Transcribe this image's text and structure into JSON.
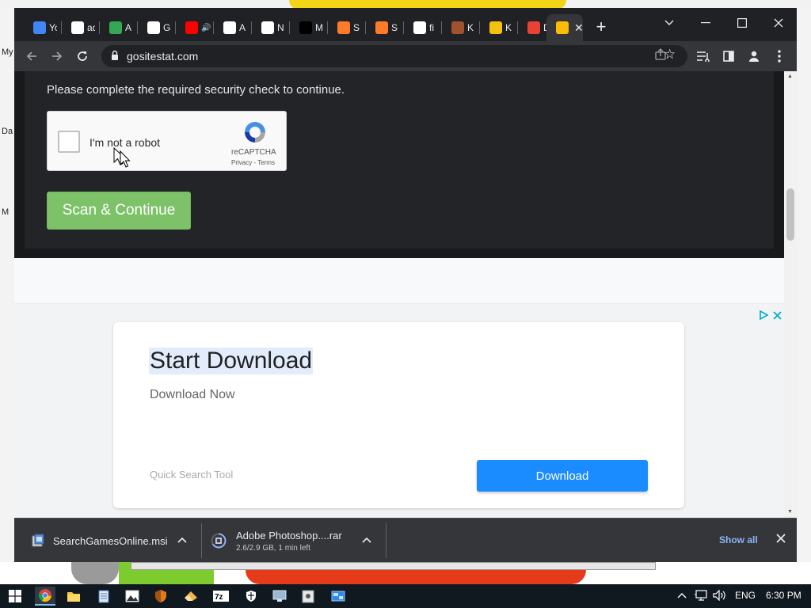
{
  "browser": {
    "tabs": [
      {
        "label": "Yo",
        "icon": "apps-icon",
        "color": "#4285f4"
      },
      {
        "label": "ad",
        "icon": "google-icon",
        "color": "#ffffff"
      },
      {
        "label": "A",
        "icon": "drive-icon",
        "color": "#34a853"
      },
      {
        "label": "G",
        "icon": "globe-icon",
        "color": "#ffffff"
      },
      {
        "label": "",
        "icon": "youtube-icon",
        "color": "#ff0000"
      },
      {
        "label": "A",
        "icon": "t-icon",
        "color": "#ffffff"
      },
      {
        "label": "N",
        "icon": "chrome-icon",
        "color": "#ffffff"
      },
      {
        "label": "M",
        "icon": "r-icon",
        "color": "#000000"
      },
      {
        "label": "S",
        "icon": "gamepad-icon",
        "color": "#ff7a29"
      },
      {
        "label": "S",
        "icon": "gamepad-icon",
        "color": "#ff7a29"
      },
      {
        "label": "fi",
        "icon": "google-icon",
        "color": "#ffffff"
      },
      {
        "label": "K",
        "icon": "avatar-icon",
        "color": "#a0522d"
      },
      {
        "label": "K",
        "icon": "wu-icon",
        "color": "#f4c20d"
      },
      {
        "label": "D",
        "icon": "spade-icon",
        "color": "#e94235"
      },
      {
        "label": "",
        "icon": "chart-icon",
        "color": "#fbbc04"
      }
    ],
    "new_tab": "+",
    "url": "gositestat.com"
  },
  "page": {
    "security_message": "Please complete the required security check to continue.",
    "recaptcha": {
      "label": "I'm not a robot",
      "brand": "reCAPTCHA",
      "terms": "Privacy - Terms"
    },
    "scan_button": "Scan & Continue"
  },
  "ad": {
    "title": "Start Download",
    "subtitle": "Download Now",
    "source": "Quick Search Tool",
    "button": "Download",
    "choices_color": "#00aecd"
  },
  "downloads": {
    "items": [
      {
        "name": "SearchGamesOnline.msi",
        "status": ""
      },
      {
        "name": "Adobe Photoshop....rar",
        "status": "2.6/2.9 GB, 1 min left"
      }
    ],
    "show_all": "Show all"
  },
  "taskbar": {
    "lang": "ENG",
    "time": "6:30 PM"
  },
  "desktop": {
    "labels": [
      "My",
      "Da",
      "M"
    ]
  }
}
